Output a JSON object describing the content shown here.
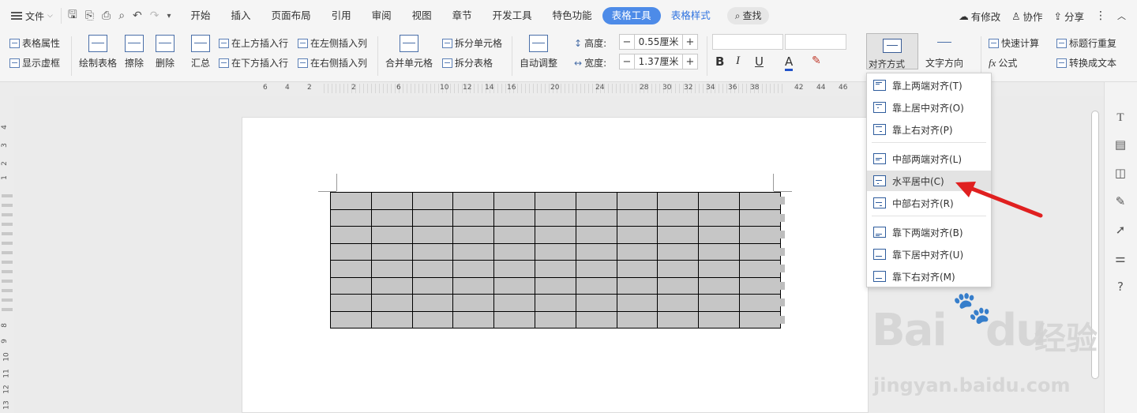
{
  "menubar": {
    "file_label": "文件",
    "tabs": [
      {
        "label": "开始"
      },
      {
        "label": "插入"
      },
      {
        "label": "页面布局"
      },
      {
        "label": "引用"
      },
      {
        "label": "审阅"
      },
      {
        "label": "视图"
      },
      {
        "label": "章节"
      },
      {
        "label": "开发工具"
      },
      {
        "label": "特色功能"
      },
      {
        "label": "表格工具"
      },
      {
        "label": "表格样式"
      }
    ],
    "search_label": "查找",
    "right": {
      "modified": "有修改",
      "collab": "协作",
      "share": "分享"
    }
  },
  "ribbon": {
    "table_props": "表格属性",
    "show_grid": "显示虚框",
    "draw_table": "绘制表格",
    "erase": "擦除",
    "delete": "删除",
    "summary": "汇总",
    "insert_above": "在上方插入行",
    "insert_below": "在下方插入行",
    "insert_left": "在左侧插入列",
    "insert_right": "在右侧插入列",
    "merge_cells": "合并单元格",
    "split_cells": "拆分单元格",
    "split_table": "拆分表格",
    "auto_fit": "自动调整",
    "height_label": "高度:",
    "height_value": "0.55厘米",
    "width_label": "宽度:",
    "width_value": "1.37厘米",
    "bold": "B",
    "italic": "I",
    "underline": "U",
    "font_color": "A",
    "alignment": "对齐方式",
    "text_direction": "文字方向",
    "quick_calc": "快速计算",
    "formula": "公式",
    "repeat_header": "标题行重复",
    "convert_text": "转换成文本"
  },
  "ruler": {
    "h_ticks": [
      "6",
      "4",
      "2",
      "2",
      "6",
      "10",
      "12",
      "14",
      "16",
      "20",
      "24",
      "28",
      "30",
      "32",
      "34",
      "36",
      "38",
      "42",
      "44",
      "46"
    ],
    "v_ticks": [
      "4",
      "3",
      "2",
      "1",
      "8",
      "9",
      "10",
      "11",
      "12",
      "13"
    ]
  },
  "table": {
    "rows": 8,
    "cols": 11
  },
  "dropdown": {
    "items": [
      {
        "label": "靠上两端对齐(T)",
        "icon": "align-top-justify-icon"
      },
      {
        "label": "靠上居中对齐(O)",
        "icon": "align-top-center-icon"
      },
      {
        "label": "靠上右对齐(P)",
        "icon": "align-top-right-icon"
      },
      {
        "label": "中部两端对齐(L)",
        "icon": "align-middle-justify-icon"
      },
      {
        "label": "水平居中(C)",
        "icon": "align-middle-center-icon"
      },
      {
        "label": "中部右对齐(R)",
        "icon": "align-middle-right-icon"
      },
      {
        "label": "靠下两端对齐(B)",
        "icon": "align-bottom-justify-icon"
      },
      {
        "label": "靠下居中对齐(U)",
        "icon": "align-bottom-center-icon"
      },
      {
        "label": "靠下右对齐(M)",
        "icon": "align-bottom-right-icon"
      }
    ],
    "highlighted": "水平居中(C)"
  },
  "watermark": {
    "brand": "Bai",
    "brand2": "du",
    "cn": "经验",
    "url": "jingyan.baidu.com"
  },
  "colors": {
    "accent": "#4d8be8",
    "arrow": "#e02020"
  }
}
